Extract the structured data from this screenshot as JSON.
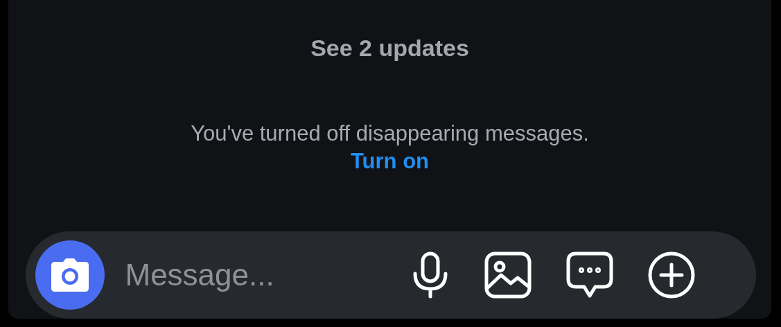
{
  "updates_link": "See 2 updates",
  "notice": {
    "text": "You've turned off disappearing messages.",
    "action": "Turn on"
  },
  "composer": {
    "placeholder": "Message...",
    "actions": [
      {
        "kind": "mic"
      },
      {
        "kind": "image"
      },
      {
        "kind": "sticker"
      },
      {
        "kind": "plus"
      }
    ]
  }
}
